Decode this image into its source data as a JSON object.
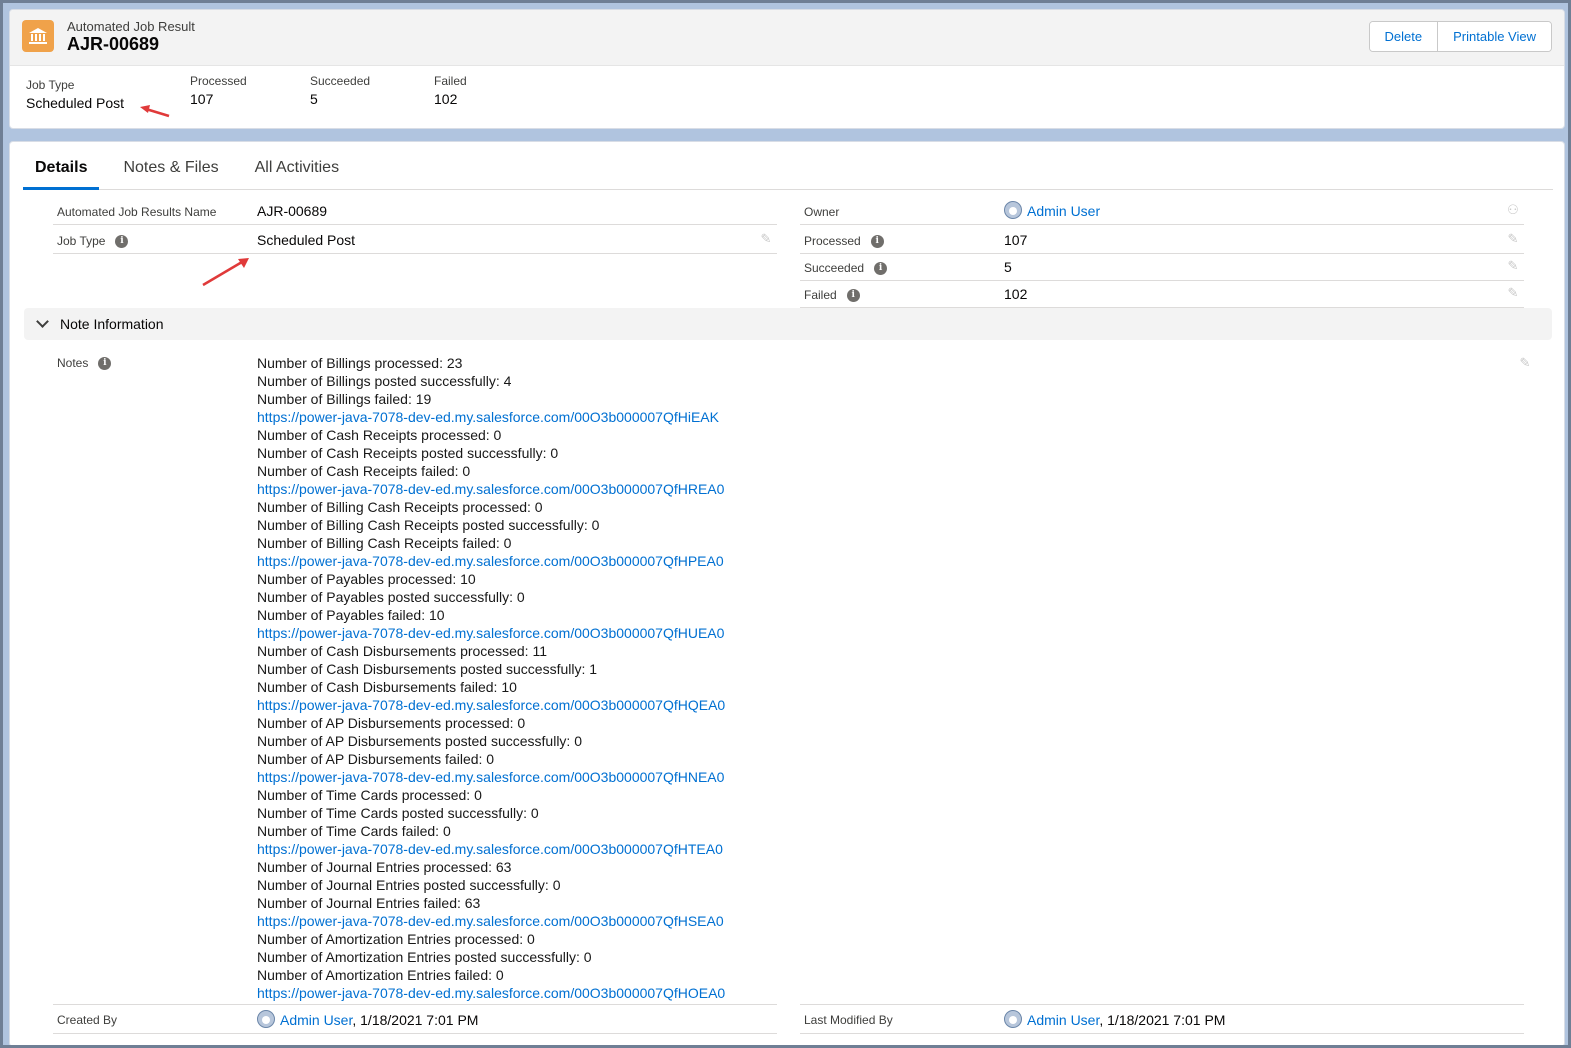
{
  "header": {
    "record_type": "Automated Job Result",
    "record_name": "AJR-00689",
    "buttons": {
      "delete": "Delete",
      "printable_view": "Printable View"
    },
    "highlights": [
      {
        "label": "Job Type",
        "value": "Scheduled Post"
      },
      {
        "label": "Processed",
        "value": "107"
      },
      {
        "label": "Succeeded",
        "value": "5"
      },
      {
        "label": "Failed",
        "value": "102"
      }
    ]
  },
  "tabs": [
    "Details",
    "Notes & Files",
    "All Activities"
  ],
  "details": {
    "left": [
      {
        "label": "Automated Job Results Name",
        "value": "AJR-00689"
      },
      {
        "label": "Job Type",
        "value": "Scheduled Post"
      }
    ],
    "right": [
      {
        "label": "Owner",
        "value": "Admin User"
      },
      {
        "label": "Processed",
        "value": "107"
      },
      {
        "label": "Succeeded",
        "value": "5"
      },
      {
        "label": "Failed",
        "value": "102"
      }
    ]
  },
  "note_section": {
    "title": "Note Information",
    "notes_label": "Notes",
    "lines": [
      {
        "text": "Number of Billings processed: 23",
        "link": false
      },
      {
        "text": "Number of Billings posted successfully: 4",
        "link": false
      },
      {
        "text": "Number of Billings failed: 19",
        "link": false
      },
      {
        "text": "https://power-java-7078-dev-ed.my.salesforce.com/00O3b000007QfHiEAK",
        "link": true
      },
      {
        "text": "Number of Cash Receipts processed: 0",
        "link": false
      },
      {
        "text": "Number of Cash Receipts posted successfully: 0",
        "link": false
      },
      {
        "text": "Number of Cash Receipts failed: 0",
        "link": false
      },
      {
        "text": "https://power-java-7078-dev-ed.my.salesforce.com/00O3b000007QfHREA0",
        "link": true
      },
      {
        "text": "Number of Billing Cash Receipts processed: 0",
        "link": false
      },
      {
        "text": "Number of Billing Cash Receipts posted successfully: 0",
        "link": false
      },
      {
        "text": "Number of Billing Cash Receipts failed: 0",
        "link": false
      },
      {
        "text": "https://power-java-7078-dev-ed.my.salesforce.com/00O3b000007QfHPEA0",
        "link": true
      },
      {
        "text": "Number of Payables processed: 10",
        "link": false
      },
      {
        "text": "Number of Payables posted successfully: 0",
        "link": false
      },
      {
        "text": "Number of Payables failed: 10",
        "link": false
      },
      {
        "text": "https://power-java-7078-dev-ed.my.salesforce.com/00O3b000007QfHUEA0",
        "link": true
      },
      {
        "text": "Number of Cash Disbursements processed: 11",
        "link": false
      },
      {
        "text": "Number of Cash Disbursements posted successfully: 1",
        "link": false
      },
      {
        "text": "Number of Cash Disbursements failed: 10",
        "link": false
      },
      {
        "text": "https://power-java-7078-dev-ed.my.salesforce.com/00O3b000007QfHQEA0",
        "link": true
      },
      {
        "text": "Number of AP Disbursements processed: 0",
        "link": false
      },
      {
        "text": "Number of AP Disbursements posted successfully: 0",
        "link": false
      },
      {
        "text": "Number of AP Disbursements failed: 0",
        "link": false
      },
      {
        "text": "https://power-java-7078-dev-ed.my.salesforce.com/00O3b000007QfHNEA0",
        "link": true
      },
      {
        "text": "Number of Time Cards processed: 0",
        "link": false
      },
      {
        "text": "Number of Time Cards posted successfully: 0",
        "link": false
      },
      {
        "text": "Number of Time Cards failed: 0",
        "link": false
      },
      {
        "text": "https://power-java-7078-dev-ed.my.salesforce.com/00O3b000007QfHTEA0",
        "link": true
      },
      {
        "text": "Number of Journal Entries processed: 63",
        "link": false
      },
      {
        "text": "Number of Journal Entries posted successfully: 0",
        "link": false
      },
      {
        "text": "Number of Journal Entries failed: 63",
        "link": false
      },
      {
        "text": "https://power-java-7078-dev-ed.my.salesforce.com/00O3b000007QfHSEA0",
        "link": true
      },
      {
        "text": "Number of Amortization Entries processed: 0",
        "link": false
      },
      {
        "text": "Number of Amortization Entries posted successfully: 0",
        "link": false
      },
      {
        "text": "Number of Amortization Entries failed: 0",
        "link": false
      },
      {
        "text": "https://power-java-7078-dev-ed.my.salesforce.com/00O3b000007QfHOEA0",
        "link": true
      }
    ]
  },
  "footer_fields": {
    "created_by": {
      "label": "Created By",
      "user": "Admin User",
      "suffix": ", 1/18/2021 7:01 PM"
    },
    "last_modified_by": {
      "label": "Last Modified By",
      "user": "Admin User",
      "suffix": ", 1/18/2021 7:01 PM"
    }
  },
  "colors": {
    "accent": "#0070d2",
    "record_icon": "#f0a24a",
    "annotation_arrow": "#e03a3a"
  },
  "icons": [
    "bank-icon",
    "info-icon",
    "pencil-icon",
    "user-avatar-icon",
    "chevron-down-icon",
    "annotation-arrow"
  ]
}
